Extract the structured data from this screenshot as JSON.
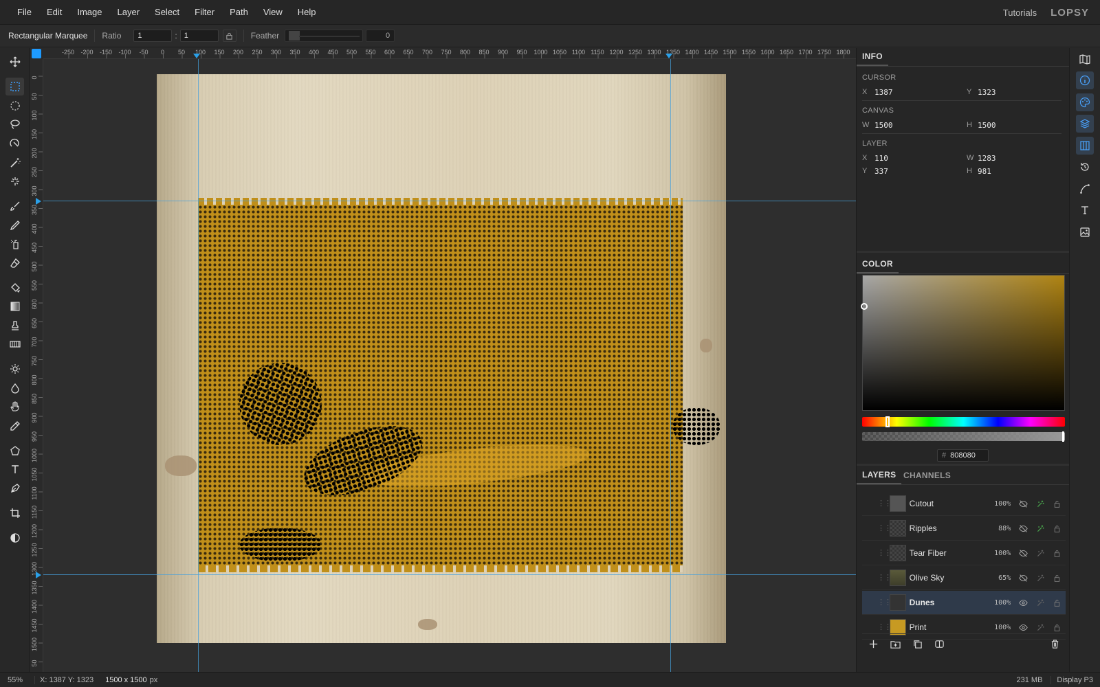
{
  "menubar": {
    "items": [
      "File",
      "Edit",
      "Image",
      "Layer",
      "Select",
      "Filter",
      "Path",
      "View",
      "Help"
    ],
    "tutorials": "Tutorials",
    "logo": "LOPSY"
  },
  "options": {
    "tool_name": "Rectangular Marquee",
    "ratio_label": "Ratio",
    "ratio_w": "1",
    "ratio_sep": ":",
    "ratio_h": "1",
    "feather_label": "Feather",
    "feather_value": "0"
  },
  "toolbar": {
    "tools": [
      "move-icon",
      "rect-marquee-icon",
      "ellipse-marquee-icon",
      "lasso-icon",
      "magnetic-lasso-icon",
      "magic-wand-icon",
      "quick-select-icon",
      "brush-icon",
      "pencil-icon",
      "spray-icon",
      "eraser-icon",
      "bucket-icon",
      "gradient-icon",
      "stamp-icon",
      "pattern-icon",
      "sun-icon",
      "drop-icon",
      "hand-icon",
      "eyedropper-icon",
      "polygon-icon",
      "text-icon",
      "pen-icon",
      "crop-icon",
      "contrast-icon"
    ],
    "active": "rect-marquee-icon"
  },
  "rulers": {
    "top": [
      "-250",
      "-200",
      "-150",
      "-100",
      "-50",
      "0",
      "50",
      "100",
      "150",
      "200",
      "250",
      "300",
      "350",
      "400",
      "450",
      "500",
      "550",
      "600",
      "650",
      "700",
      "750",
      "800",
      "850",
      "900",
      "950",
      "1000",
      "1050",
      "1100",
      "1150",
      "1200",
      "1250",
      "1300",
      "1350",
      "1400",
      "1450",
      "1500",
      "1550",
      "1600",
      "1650",
      "1700",
      "1750",
      "1800"
    ],
    "left": [
      "0",
      "50",
      "100",
      "150",
      "200",
      "250",
      "300",
      "350",
      "400",
      "450",
      "500",
      "550",
      "600",
      "650",
      "700",
      "750",
      "800",
      "850",
      "900",
      "950",
      "1000",
      "1050",
      "1100",
      "1150",
      "1200",
      "1250",
      "1300",
      "1350",
      "1400",
      "1450",
      "1500",
      "50"
    ]
  },
  "info": {
    "tab": "INFO",
    "cursor_label": "CURSOR",
    "cursor_x": "1387",
    "cursor_y": "1323",
    "canvas_label": "CANVAS",
    "canvas_w": "1500",
    "canvas_h": "1500",
    "layer_label": "LAYER",
    "layer_x": "110",
    "layer_y": "337",
    "layer_w": "1283",
    "layer_h": "981",
    "x": "X",
    "y": "Y",
    "w": "W",
    "h": "H"
  },
  "color": {
    "tab": "COLOR",
    "hex": "808080",
    "hash": "#",
    "field_hue_color": "#b08412"
  },
  "layers": {
    "tab": "LAYERS",
    "channels_tab": "CHANNELS",
    "rows": [
      {
        "name": "Cutout",
        "opacity": "100%",
        "visible": false,
        "fx": true,
        "thumb": "cutout"
      },
      {
        "name": "Ripples",
        "opacity": "88%",
        "visible": false,
        "fx": true,
        "thumb": "blank"
      },
      {
        "name": "Tear Fiber",
        "opacity": "100%",
        "visible": false,
        "fx": false,
        "thumb": "blank"
      },
      {
        "name": "Olive Sky",
        "opacity": "65%",
        "visible": false,
        "fx": false,
        "thumb": "olive"
      },
      {
        "name": "Dunes",
        "opacity": "100%",
        "visible": true,
        "fx": false,
        "thumb": "dunes",
        "selected": true
      },
      {
        "name": "Print",
        "opacity": "100%",
        "visible": true,
        "fx": false,
        "thumb": "print"
      }
    ]
  },
  "rightbar": [
    "map-icon",
    "info-icon",
    "palette-icon",
    "layers-icon",
    "columns-icon",
    "history-icon",
    "curve-icon",
    "type-icon",
    "image-edit-icon"
  ],
  "status": {
    "zoom": "55%",
    "cursor": "X: 1387 Y: 1323",
    "size": "1500 x 1500",
    "size_unit": "px",
    "memory": "231 MB",
    "profile": "Display P3"
  }
}
